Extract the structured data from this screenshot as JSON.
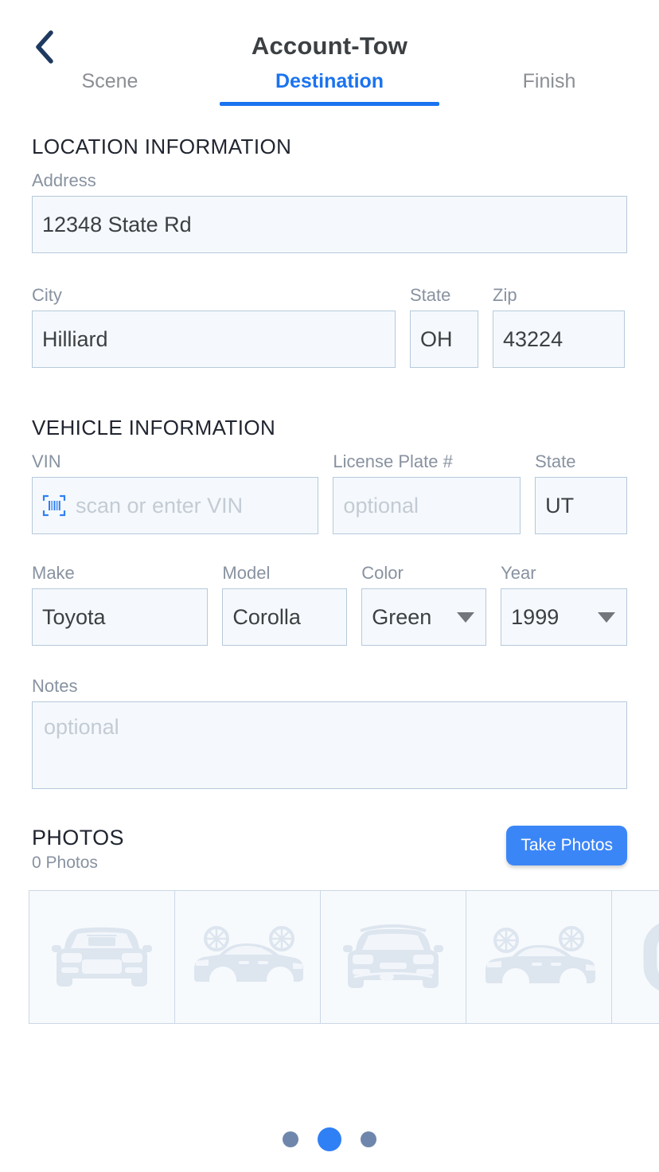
{
  "header": {
    "back_icon": "chevron-left-icon",
    "title": "Account-Tow",
    "tabs": [
      {
        "label": "Scene",
        "active": false
      },
      {
        "label": "Destination",
        "active": true
      },
      {
        "label": "Finish",
        "active": false
      }
    ]
  },
  "location": {
    "section_title": "LOCATION INFORMATION",
    "address": {
      "label": "Address",
      "value": "12348 State Rd"
    },
    "city": {
      "label": "City",
      "value": "Hilliard"
    },
    "state": {
      "label": "State",
      "value": "OH"
    },
    "zip": {
      "label": "Zip",
      "value": "43224"
    }
  },
  "vehicle": {
    "section_title": "VEHICLE INFORMATION",
    "vin": {
      "label": "VIN",
      "placeholder": "scan or enter VIN",
      "value": "",
      "icon": "barcode-scan-icon"
    },
    "plate": {
      "label": "License Plate #",
      "placeholder": "optional",
      "value": ""
    },
    "state": {
      "label": "State",
      "value": "UT"
    },
    "make": {
      "label": "Make",
      "value": "Toyota"
    },
    "model": {
      "label": "Model",
      "value": "Corolla"
    },
    "color": {
      "label": "Color",
      "value": "Green"
    },
    "year": {
      "label": "Year",
      "value": "1999"
    },
    "notes": {
      "label": "Notes",
      "placeholder": "optional",
      "value": ""
    }
  },
  "photos": {
    "section_title": "PHOTOS",
    "count_label": "0 Photos",
    "take_photos_label": "Take Photos",
    "thumbnails": [
      {
        "name": "car-front-view-placeholder"
      },
      {
        "name": "car-side-view-placeholder"
      },
      {
        "name": "car-front-view-placeholder"
      },
      {
        "name": "car-side-view-placeholder"
      },
      {
        "name": "car-wheel-placeholder"
      }
    ]
  },
  "pager": {
    "dots": [
      {
        "active": false
      },
      {
        "active": true
      },
      {
        "active": false
      }
    ]
  },
  "colors": {
    "accent_blue": "#1a73f0",
    "button_blue": "#3b86f7",
    "dot_blue": "#2f80f5",
    "dot_gray": "#6f86ac",
    "field_bg": "#f5f9fd",
    "field_border": "#b6c9db",
    "label_gray": "#8892a0",
    "back_navy": "#1e3a60"
  }
}
